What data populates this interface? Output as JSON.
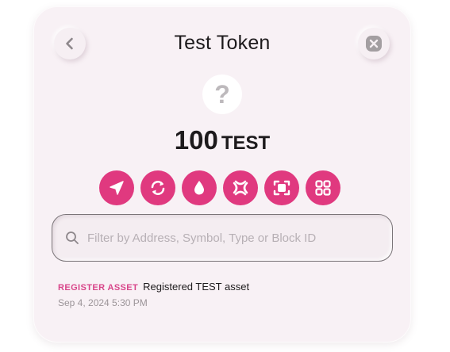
{
  "header": {
    "title": "Test Token",
    "back_icon": "chevron-left-icon",
    "close_icon": "close-x-icon"
  },
  "token": {
    "icon_text": "?",
    "amount": "100",
    "symbol": "TEST"
  },
  "actions": [
    {
      "name": "send",
      "icon": "send-arrow-icon"
    },
    {
      "name": "swap",
      "icon": "swap-refresh-icon"
    },
    {
      "name": "faucet",
      "icon": "droplet-icon"
    },
    {
      "name": "bridge",
      "icon": "bridge-x-icon"
    },
    {
      "name": "scan",
      "icon": "scan-frame-icon"
    },
    {
      "name": "apps",
      "icon": "grid-apps-icon"
    }
  ],
  "search": {
    "placeholder": "Filter by Address, Symbol, Type or Block ID",
    "value": ""
  },
  "activity": [
    {
      "type": "REGISTER ASSET",
      "description": "Registered TEST asset",
      "timestamp": "Sep 4, 2024 5:30 PM"
    }
  ],
  "colors": {
    "accent": "#e0397f",
    "accent_text": "#d8468a",
    "card_bg": "#f8f1f5",
    "text": "#1d1a1c",
    "muted": "#9b9498"
  }
}
